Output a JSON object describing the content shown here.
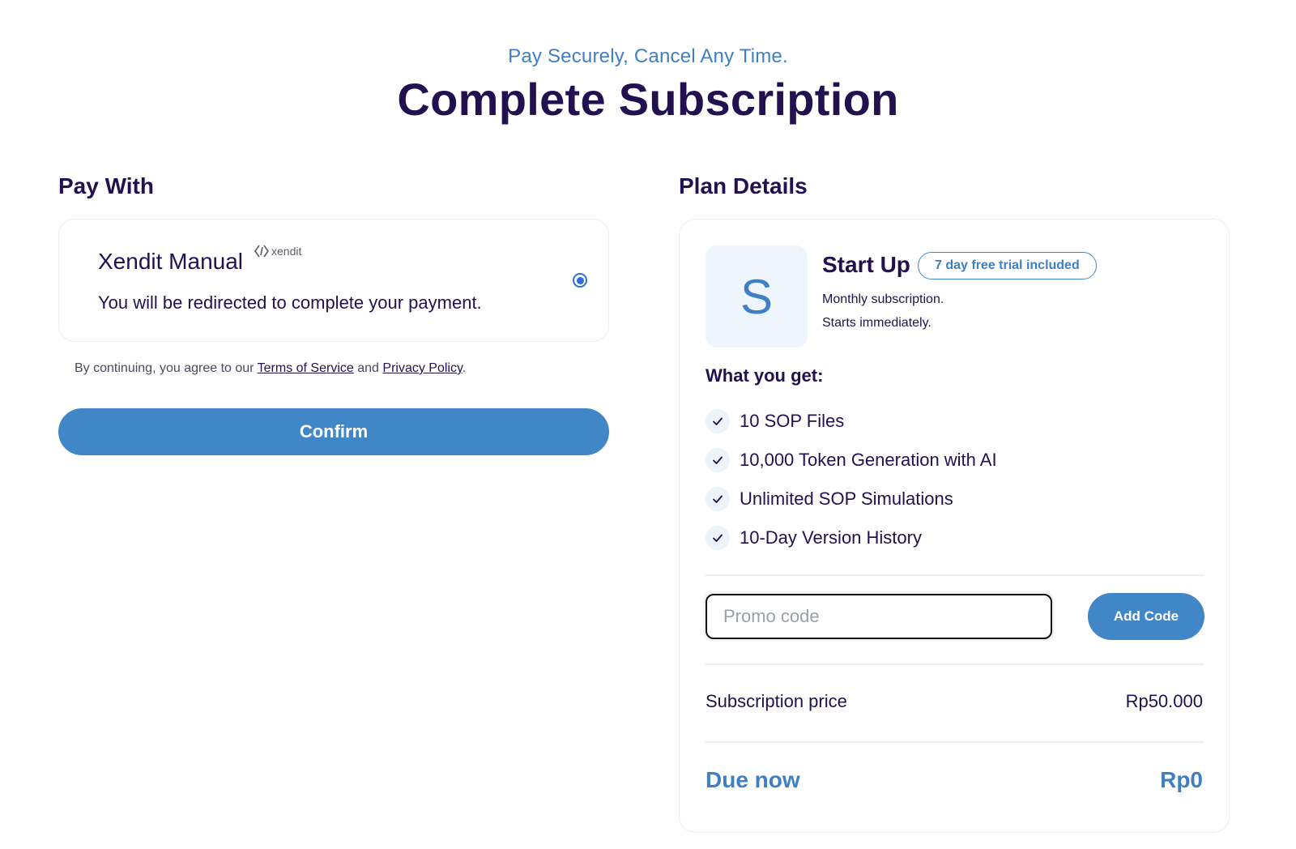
{
  "header": {
    "tagline": "Pay Securely, Cancel Any Time.",
    "title": "Complete Subscription"
  },
  "pay_with": {
    "heading": "Pay With",
    "method": {
      "name": "Xendit Manual",
      "logo_text": "xendit",
      "description": "You will be redirected to complete your payment.",
      "selected": true
    },
    "terms": {
      "prefix": "By continuing, you agree to our",
      "terms_link": "Terms of Service",
      "conjunction": "and",
      "privacy_link": "Privacy Policy",
      "suffix": "."
    },
    "confirm_label": "Confirm"
  },
  "plan_details": {
    "heading": "Plan Details",
    "avatar_letter": "S",
    "plan_name": "Start Up",
    "trial_badge": "7 day free trial included",
    "subtitle_1": "Monthly subscription.",
    "subtitle_2": "Starts immediately.",
    "benefits_heading": "What you get:",
    "benefits": [
      {
        "label": "10 SOP Files"
      },
      {
        "label": "10,000 Token Generation with AI"
      },
      {
        "label": "Unlimited SOP Simulations"
      },
      {
        "label": "10-Day Version History"
      }
    ],
    "promo": {
      "placeholder": "Promo code",
      "value": "",
      "button_label": "Add Code"
    },
    "subscription_price": {
      "label": "Subscription price",
      "value": "Rp50.000"
    },
    "due_now": {
      "label": "Due now",
      "value": "Rp0"
    }
  },
  "colors": {
    "primary": "#4186c7",
    "accent_text": "#3f7fc3",
    "heading_text": "#22104f",
    "radio": "#2f6fd6",
    "avatar_bg": "#eef5fc"
  }
}
